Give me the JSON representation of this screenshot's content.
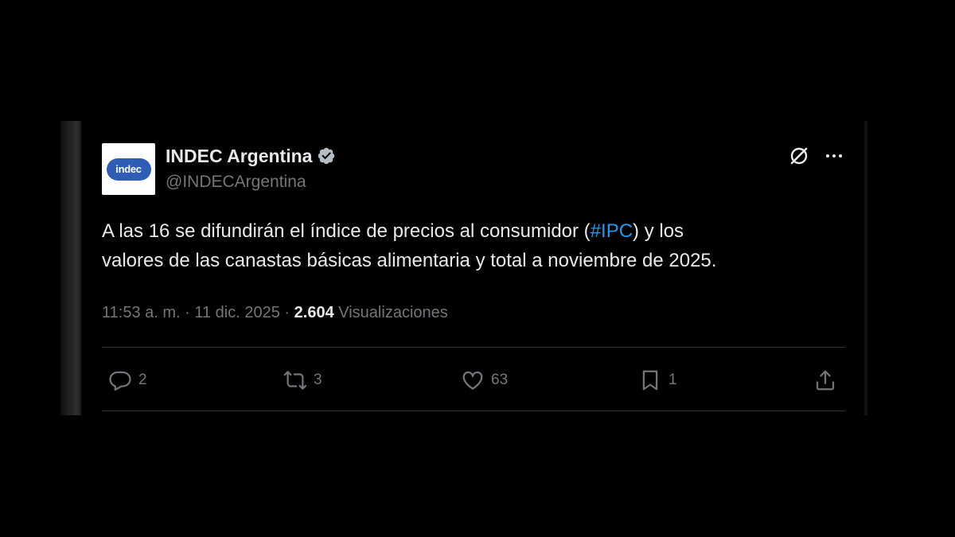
{
  "account": {
    "display_name": "INDEC Argentina",
    "handle": "@INDECArgentina",
    "avatar_text": "indec",
    "verified_icon": "verified-badge-icon"
  },
  "tweet": {
    "text_before": "A las 16 se difundirán el índice de precios al consumidor (",
    "hashtag": "#IPC",
    "text_after": ") y los\nvalores de las canastas básicas alimentaria y total a noviembre de 2025."
  },
  "meta": {
    "time": "11:53 a. m.",
    "separator1": " · ",
    "date": "11 dic. 2025",
    "separator2": " · ",
    "views_count": "2.604",
    "views_label": " Visualizaciones"
  },
  "actions": {
    "replies": "2",
    "reposts": "3",
    "likes": "63",
    "bookmarks": "1"
  },
  "colors": {
    "background": "#000000",
    "text_primary": "#e7e9ea",
    "text_secondary": "#71767b",
    "link": "#1d9bf0",
    "divider": "#2f3336",
    "avatar_badge": "#2f5db5"
  }
}
